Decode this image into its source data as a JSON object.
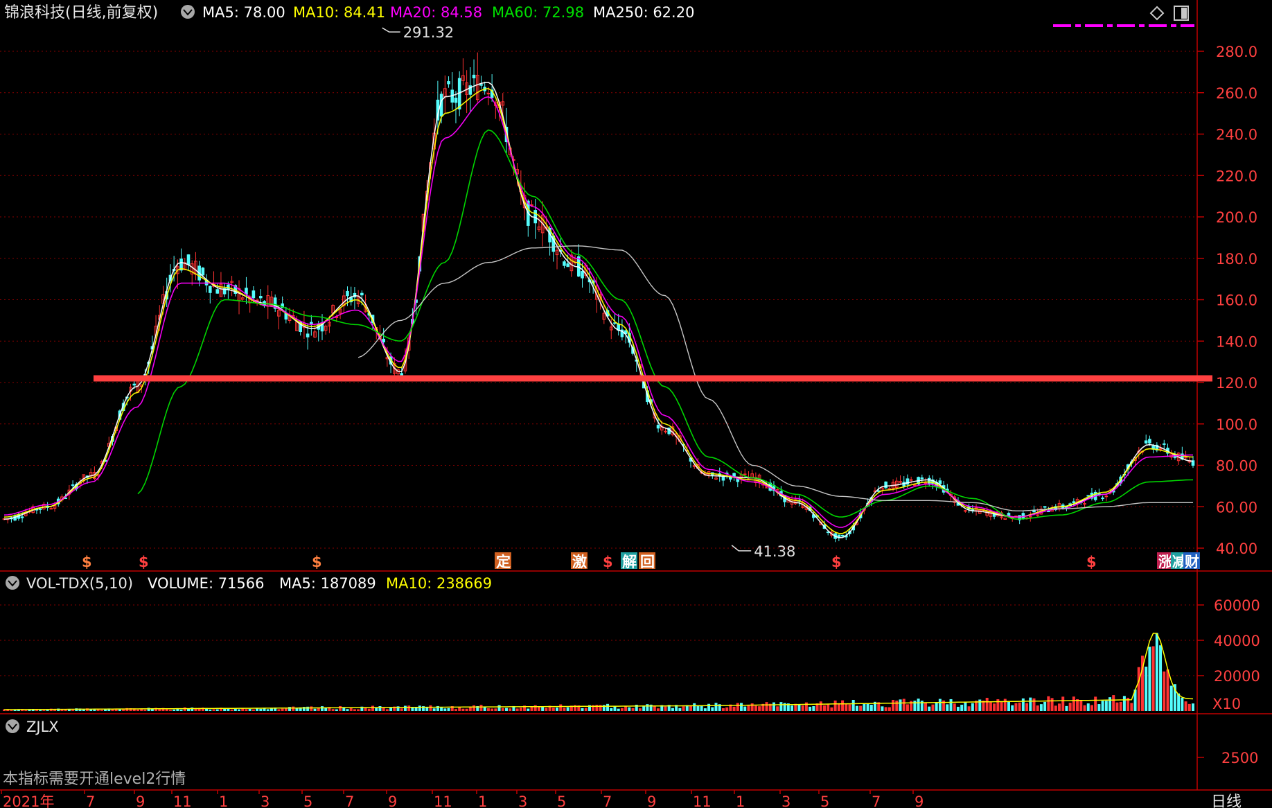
{
  "header": {
    "title": "锦浪科技(日线,前复权)",
    "ma": [
      {
        "label": "MA5: 78.00",
        "color": "#ffffff"
      },
      {
        "label": "MA10: 84.41",
        "color": "#ffff00"
      },
      {
        "label": "MA20: 84.58",
        "color": "#ff00ff"
      },
      {
        "label": "MA60: 72.98",
        "color": "#00e000"
      },
      {
        "label": "MA250: 62.20",
        "color": "#ffffff"
      }
    ]
  },
  "volume_header": {
    "label": "VOL-TDX(5,10)",
    "items": [
      {
        "label": "VOLUME: 71566",
        "color": "#ffffff"
      },
      {
        "label": "MA5: 187089",
        "color": "#ffffff"
      },
      {
        "label": "MA10: 238669",
        "color": "#ffff00"
      }
    ]
  },
  "zjlx": {
    "label": "ZJLX",
    "notice": "本指标需要开通level2行情",
    "tick": "2500"
  },
  "price_axis": {
    "ticks": [
      "280.0",
      "260.0",
      "240.0",
      "220.0",
      "200.0",
      "180.0",
      "160.0",
      "140.0",
      "120.0",
      "100.0",
      "80.00",
      "60.00",
      "40.00"
    ]
  },
  "volume_axis": {
    "ticks": [
      "60000",
      "40000",
      "20000"
    ],
    "unit": "X10"
  },
  "time_axis": {
    "labels": [
      "2021年",
      "7",
      "9",
      "11",
      "1",
      "3",
      "5",
      "7",
      "9",
      "11",
      "1",
      "3",
      "5",
      "7",
      "9",
      "11",
      "1",
      "3",
      "5",
      "7",
      "9"
    ],
    "period": "日线"
  },
  "markers": [
    "$",
    "$",
    "$",
    "定",
    "激",
    "$",
    "解",
    "回",
    "$",
    "$",
    "涨",
    "减",
    "财"
  ],
  "colors": {
    "up": "#ff3232",
    "down": "#54fcfc",
    "ma5": "#ffffff",
    "ma10": "#ffff00",
    "ma20": "#ff00ff",
    "ma60": "#00e000",
    "ma250": "#d0d0d0",
    "hline": "#ff4040",
    "axis": "#c00000"
  },
  "chart_data": {
    "type": "line",
    "title": "锦浪科技(日线,前复权)",
    "ylim": [
      35,
      295
    ],
    "high_label": "291.32",
    "low_label": "41.38",
    "horizontal_line": 122,
    "x": [
      "2021年",
      "7",
      "9",
      "11",
      "1",
      "3",
      "5",
      "7",
      "9",
      "11",
      "1",
      "3",
      "5",
      "7",
      "9",
      "11",
      "1",
      "3",
      "5",
      "7",
      "9"
    ],
    "series": [
      {
        "name": "MA5",
        "values": [
          54,
          60,
          75,
          118,
          178,
          165,
          158,
          146,
          162,
          125,
          258,
          265,
          200,
          176,
          145,
          98,
          75,
          74,
          62,
          45,
          70,
          73,
          58,
          55,
          60,
          66,
          90,
          82
        ]
      },
      {
        "name": "MA10",
        "values": [
          55,
          60,
          74,
          115,
          175,
          166,
          157,
          147,
          160,
          127,
          250,
          262,
          202,
          178,
          148,
          100,
          76,
          73,
          63,
          47,
          68,
          72,
          59,
          55,
          60,
          67,
          88,
          84
        ]
      },
      {
        "name": "MA20",
        "values": [
          56,
          61,
          72,
          108,
          168,
          168,
          157,
          148,
          155,
          130,
          238,
          258,
          205,
          180,
          152,
          104,
          78,
          72,
          64,
          50,
          66,
          71,
          60,
          55,
          59,
          66,
          84,
          85
        ]
      },
      {
        "name": "MA60",
        "values": [
          null,
          null,
          null,
          66,
          118,
          160,
          158,
          152,
          148,
          140,
          178,
          242,
          210,
          182,
          160,
          118,
          84,
          74,
          66,
          55,
          63,
          70,
          64,
          54,
          56,
          62,
          72,
          73
        ]
      },
      {
        "name": "MA250",
        "values": [
          null,
          null,
          null,
          null,
          null,
          null,
          null,
          null,
          132,
          150,
          168,
          178,
          185,
          186,
          184,
          162,
          112,
          80,
          70,
          65,
          63,
          63,
          62,
          58,
          59,
          60,
          62,
          62
        ]
      }
    ],
    "volume": {
      "ylim": [
        0,
        65000
      ],
      "ma5": 187089,
      "ma10": 238669,
      "volume": 71566
    }
  }
}
